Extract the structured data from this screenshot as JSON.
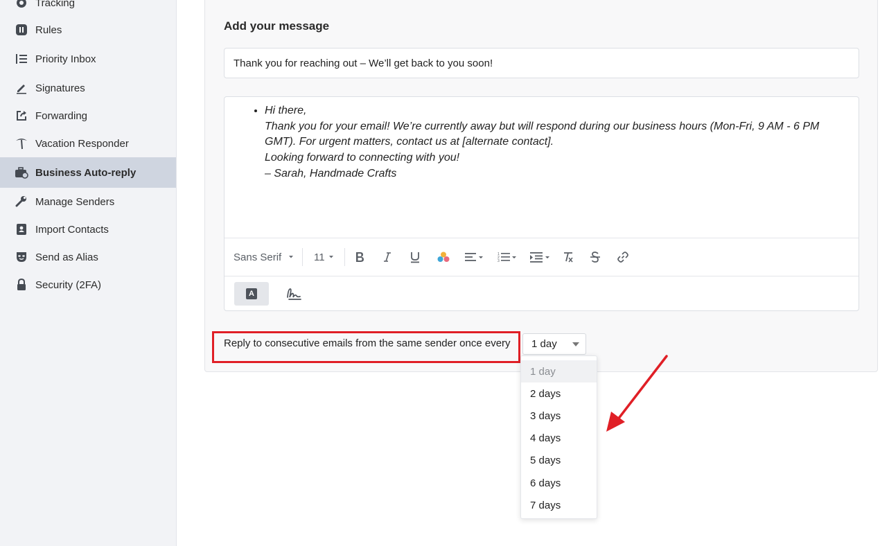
{
  "sidebar": {
    "items": [
      {
        "label": "Tracking",
        "icon": "eye-icon"
      },
      {
        "label": "Rules",
        "icon": "rules-icon"
      },
      {
        "label": "Priority Inbox",
        "icon": "priority-list-icon"
      },
      {
        "label": "Signatures",
        "icon": "pen-icon"
      },
      {
        "label": "Forwarding",
        "icon": "forward-share-icon"
      },
      {
        "label": "Vacation Responder",
        "icon": "palm-tree-icon"
      },
      {
        "label": "Business Auto-reply",
        "icon": "briefcase-clock-icon",
        "active": true
      },
      {
        "label": "Manage Senders",
        "icon": "wrench-icon"
      },
      {
        "label": "Import Contacts",
        "icon": "contact-book-icon"
      },
      {
        "label": "Send as Alias",
        "icon": "mask-icon"
      },
      {
        "label": "Security (2FA)",
        "icon": "lock-icon"
      }
    ]
  },
  "main": {
    "section_title": "Add your message",
    "subject_value": "Thank you for reaching out – We’ll get back to you soon!",
    "message_lines": [
      "Hi there,",
      "Thank you for your email! We’re currently away but will respond during our business hours (Mon-Fri, 9 AM - 6 PM",
      "GMT). For urgent matters, contact us at [alternate contact].",
      "Looking forward to connecting with you!",
      "– Sarah, Handmade Crafts"
    ],
    "toolbar": {
      "font_family": "Sans Serif",
      "font_size": "11",
      "buttons": [
        "bold-icon",
        "italic-icon",
        "underline-icon",
        "color-icon",
        "align-icon",
        "ordered-list-icon",
        "indent-icon",
        "clear-format-icon",
        "strikethrough-icon",
        "link-icon"
      ]
    },
    "frequency": {
      "label": "Reply to consecutive emails from the same sender once every",
      "selected": "1 day",
      "options": [
        "1 day",
        "2 days",
        "3 days",
        "4 days",
        "5 days",
        "6 days",
        "7 days"
      ]
    }
  },
  "colors": {
    "highlight": "#e01f26",
    "sidebar_bg": "#f2f3f6",
    "active_item_bg": "#cfd5e0"
  }
}
